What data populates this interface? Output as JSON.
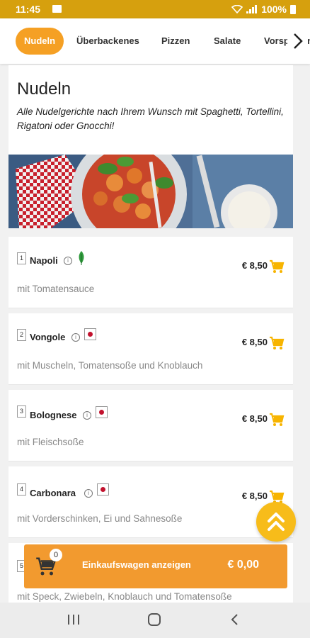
{
  "status": {
    "time": "11:45",
    "battery": "100%"
  },
  "tabs": [
    "Nudeln",
    "Überbackenes",
    "Pizzen",
    "Salate",
    "Vorspeisen"
  ],
  "category": {
    "title": "Nudeln",
    "description": "Alle Nudelgerichte nach Ihrem Wunsch mit Spaghetti, Tortellini, Rigatoni oder Gnocchi!"
  },
  "items": [
    {
      "num": "1",
      "name": "Napoli",
      "price": "€ 8,50",
      "desc": "mit Tomatensauce"
    },
    {
      "num": "2",
      "name": "Vongole",
      "price": "€ 8,50",
      "desc": "mit Muscheln, Tomatensoße und Knoblauch"
    },
    {
      "num": "3",
      "name": "Bolognese",
      "price": "€ 8,50",
      "desc": "mit Fleischsoße"
    },
    {
      "num": "4",
      "name": "Carbonara",
      "price": "€ 8,50",
      "desc": "mit Vorderschinken, Ei und Sahnesoße"
    },
    {
      "num": "5",
      "name": "",
      "price": "",
      "desc": "mit Speck, Zwiebeln, Knoblauch und Tomatensoße"
    }
  ],
  "cart": {
    "count": "0",
    "label": "Einkaufswagen anzeigen",
    "total": "€ 0,00"
  },
  "colors": {
    "status_bar": "#d6a00e",
    "accent": "#f5a024",
    "cart_icon": "#f7b400",
    "cart_bar": "#f29a2f",
    "fab": "#f7bc1a"
  }
}
